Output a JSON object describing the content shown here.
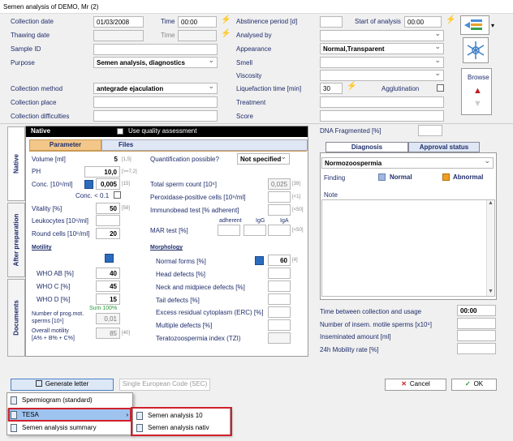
{
  "window": {
    "title": "Semen analysis of DEMO, Mr (2)"
  },
  "top_left": {
    "collection_date_label": "Collection date",
    "collection_date": "01/03/2008",
    "time_label": "Time",
    "time": "00:00",
    "thawing_date_label": "Thawing date",
    "time2_label": "Time",
    "sample_id_label": "Sample ID",
    "purpose_label": "Purpose",
    "purpose": "Semen analysis, diagnostics",
    "collection_method_label": "Collection method",
    "collection_method": "antegrade ejaculation",
    "collection_place_label": "Collection place",
    "collection_difficulties_label": "Collection difficulties"
  },
  "top_right": {
    "abstinence_label": "Abstinence period [d]",
    "start_label": "Start of analysis",
    "start_time": "00:00",
    "analysed_by_label": "Analysed by",
    "appearance_label": "Appearance",
    "appearance": "Normal,Transparent",
    "smell_label": "Smell",
    "viscosity_label": "Viscosity",
    "liquefaction_label": "Liquefaction time [min]",
    "liquefaction": "30",
    "agglutination_label": "Agglutination",
    "treatment_label": "Treatment",
    "score_label": "Score",
    "browse_label": "Browse"
  },
  "side_tabs": [
    "Native",
    "After preparation",
    "Documents"
  ],
  "native": {
    "header": "Native",
    "quality_label": "Use quality assessment",
    "tab_parameter": "Parameter",
    "tab_files": "Files",
    "volume_label": "Volume [ml]",
    "volume": "5",
    "volume_ref": "[1,5]",
    "ph_label": "PH",
    "ph": "10,0",
    "ph_ref": "[>=7,2]",
    "conc_label": "Conc. [10⁶/ml]",
    "conc": "0,005",
    "conc_ref": "[15]",
    "conc_lt_label": "Conc. < 0.1",
    "vitality_label": "Vitality [%]",
    "vitality": "50",
    "vitality_ref": "[58]",
    "leukocytes_label": "Leukocytes [10⁶/ml]",
    "round_cells_label": "Round cells [10⁶/ml]",
    "round_cells": "20",
    "motility_label": "Motility",
    "who_ab_label": "WHO AB [%]",
    "who_ab": "40",
    "who_c_label": "WHO C [%]",
    "who_c": "45",
    "who_d_label": "WHO D [%]",
    "who_d": "15",
    "sum_label": "Sum 100%",
    "prog_motile_label_1": "Number of prog.mot.",
    "prog_motile_label_2": "sperms [10⁶]",
    "prog_motile": "0,01",
    "overall_label_1": "Overall motility",
    "overall_label_2": "[A% + B% + C%]",
    "overall": "85",
    "overall_ref": "[40]",
    "quant_label": "Quantification possible?",
    "quant": "Not specified",
    "total_label": "Total sperm count [10⁶]",
    "total": "0,025",
    "total_ref": "[39]",
    "perox_label": "Peroxidase-positive cells [10⁶/ml]",
    "perox_ref": "[<1]",
    "immuno_label": "Immunobead test [% adherent]",
    "immuno_ref": "[<50]",
    "mar_adherent": "adherent",
    "mar_igg": "IgG",
    "mar_iga": "IgA",
    "mar_label": "MAR test [%]",
    "mar_ref": "[<50]",
    "morph_label": "Morphology",
    "normal_label": "Normal forms [%]",
    "normal": "60",
    "normal_ref": "[4]",
    "head_label": "Head defects [%]",
    "neck_label": "Neck and midpiece defects [%]",
    "tail_label": "Tail defects [%]",
    "erc_label": "Excess residual cytoplasm (ERC) [%]",
    "multiple_label": "Multiple defects [%]",
    "tzi_label": "Teratozoospermia index (TZI)"
  },
  "diagnosis": {
    "dna_label": "DNA Fragmented [%]",
    "tab_diagnosis": "Diagnosis",
    "tab_approval": "Approval status",
    "diagnosis_value": "Normozoospermia",
    "finding_label": "Finding",
    "normal_label": "Normal",
    "abnormal_label": "Abnormal",
    "note_label": "Note",
    "time_between_label": "Time between collection and usage",
    "time_between": "00:00",
    "insem_label": "Number of insem. motile sperms [x10⁶]",
    "insem_amount_label": "Inseminated amount [ml]",
    "mobility_label": "24h Mobility rate [%]"
  },
  "bottom": {
    "generate_letter": "Generate letter",
    "sec": "Single European Code (SEC)",
    "cancel": "Cancel",
    "ok": "OK"
  },
  "menu": {
    "items": [
      "Spermiogram (standard)",
      "TESA",
      "Semen analysis summary"
    ],
    "submenu": [
      "Semen analysis 10",
      "Semen analysis nativ"
    ]
  },
  "colors": {
    "highlight_border": "#d0202a",
    "menu_highlight": "#9fc3ef",
    "dark_header": "#000000",
    "tab_orange": "#f3c789"
  }
}
